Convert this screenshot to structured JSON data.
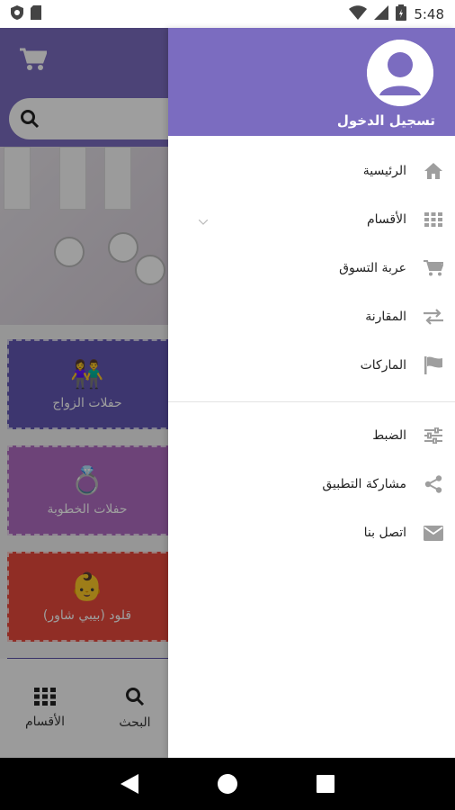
{
  "status_bar": {
    "time": "5:48"
  },
  "background": {
    "cards": [
      {
        "label": "حفلات الزواج",
        "icon": "couple-icon",
        "color": "#6357b3"
      },
      {
        "label": "حفلات الخطوبة",
        "icon": "rings-icon",
        "color": "#b06cc2"
      },
      {
        "label": "قلود (بيبي شاور)",
        "icon": "baby-icon",
        "color": "#e84a3c"
      }
    ],
    "bottom_tabs": [
      {
        "label": "البحث",
        "icon": "search-icon"
      },
      {
        "label": "الأقسام",
        "icon": "grid-icon"
      }
    ]
  },
  "drawer": {
    "header": {
      "login_label": "تسجيل الدخول",
      "color": "#7b6cc0"
    },
    "primary_items": [
      {
        "label": "الرئيسية",
        "icon": "home-icon"
      },
      {
        "label": "الأقسام",
        "icon": "grid-icon",
        "expandable": true
      },
      {
        "label": "عربة التسوق",
        "icon": "cart-icon"
      },
      {
        "label": "المقارنة",
        "icon": "compare-icon"
      },
      {
        "label": "الماركات",
        "icon": "flag-icon"
      }
    ],
    "secondary_items": [
      {
        "label": "الضبط",
        "icon": "settings-sliders-icon"
      },
      {
        "label": "مشاركة التطبيق",
        "icon": "share-icon"
      },
      {
        "label": "اتصل بنا",
        "icon": "mail-icon"
      }
    ]
  },
  "colors": {
    "accent": "#7b6cc0",
    "icon_gray": "#9e9e9e"
  }
}
